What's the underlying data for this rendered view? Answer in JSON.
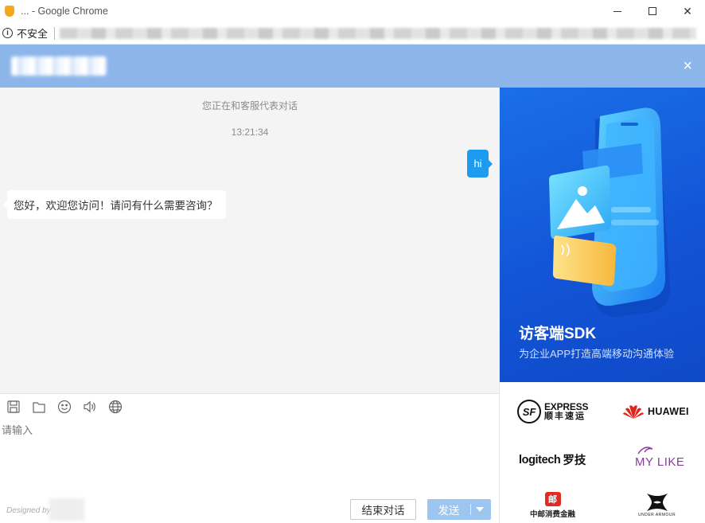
{
  "window": {
    "title": "... - Google Chrome",
    "minimize_icon": "minimize-icon",
    "maximize_icon": "maximize-icon",
    "close_glyph": "✕"
  },
  "address_bar": {
    "info_glyph": "i",
    "security_label": "不安全"
  },
  "chat_header": {
    "close_glyph": "×"
  },
  "conversation": {
    "system_note": "您正在和客服代表对话",
    "timestamp": "13:21:34",
    "user_message": "hi",
    "agent_message": "您好，欢迎您访问！请问有什么需要咨询？"
  },
  "toolbar": {
    "icons": [
      "save-icon",
      "folder-icon",
      "emoji-icon",
      "voice-icon",
      "globe-icon"
    ]
  },
  "input": {
    "placeholder": "请输入"
  },
  "footer": {
    "designed_by": "Designed by",
    "end_button": "结束对话",
    "send_button": "发送"
  },
  "ad": {
    "title": "访客端SDK",
    "subtitle": "为企业APP打造高端移动沟通体验"
  },
  "client_logos": {
    "sf_badge": "SF",
    "sf_en": "EXPRESS",
    "sf_cn": "顺丰速运",
    "huawei": "HUAWEI",
    "logitech_en": "logitech",
    "logitech_cn": "罗技",
    "mylike": "MY LIKE",
    "zhongyou_mark": "邮",
    "zhongyou": "中邮消费金融",
    "under_armour": "UNDER ARMOUR"
  },
  "colors": {
    "header": "#8cb5ea",
    "user_bubble": "#1d9bf0",
    "send_button": "#9cc6f0",
    "ad_background": "#1255d6"
  }
}
